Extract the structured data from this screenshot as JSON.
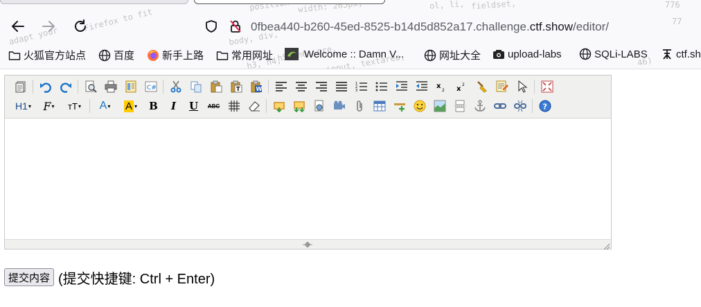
{
  "browser": {
    "url_domain_prefix": "0fbea440-b260-45ed-8525-b14d5d852a17.challenge.",
    "url_domain_main": "ctf.show",
    "url_path": "/editor/",
    "theme_text": [
      "position",
      "width: 265px;",
      "ol, li,",
      "fieldset,",
      "adapt your",
      "Firefox to fit",
      "body, div,",
      "h5, h6, pre,",
      "input, textarea,",
      "776",
      "77",
      "46)",
      "h3, h4,"
    ],
    "nav_icons": [
      "back-arrow-icon",
      "forward-arrow-icon",
      "reload-icon",
      "shield-icon",
      "insecure-lock-icon"
    ]
  },
  "bookmarks": [
    {
      "label": "火狐官方站点",
      "icon": "folder-icon"
    },
    {
      "label": "百度",
      "icon": "globe-icon"
    },
    {
      "label": "新手上路",
      "icon": "firefox-icon"
    },
    {
      "label": "常用网址",
      "icon": "folder-icon"
    },
    {
      "label": "Welcome :: Damn V...",
      "icon": "dvwa-icon"
    },
    {
      "label": "网址大全",
      "icon": "globe-icon"
    },
    {
      "label": "upload-labs",
      "icon": "camera-icon"
    },
    {
      "label": "SQLi-LABS",
      "icon": "globe-icon"
    },
    {
      "label": "ctf.sh",
      "icon": "ctfshow-icon"
    }
  ],
  "editor": {
    "toolbar_row1": [
      "source",
      "undo",
      "redo",
      "preview",
      "print",
      "template",
      "code",
      "cut",
      "copy",
      "paste",
      "paste-text",
      "paste-word",
      "justify-left",
      "justify-center",
      "justify-right",
      "justify-full",
      "ordered-list",
      "unordered-list",
      "indent",
      "outdent",
      "subscript",
      "superscript",
      "clear-format",
      "select-all",
      "cursor",
      "fullscreen"
    ],
    "toolbar_row2_text": {
      "heading": "H1",
      "font": "F",
      "size": "тT",
      "fore": "A",
      "back": "A",
      "bold": "B",
      "italic": "I",
      "underline": "U",
      "strike": "ABC"
    },
    "toolbar_row2": [
      "table-grid",
      "eraser",
      "image",
      "multi-image",
      "flash",
      "media",
      "attachment",
      "insert-table",
      "horizontal-rule",
      "emoticon",
      "baidu-map",
      "page-break",
      "anchor",
      "link",
      "unlink",
      "help"
    ],
    "accent_color": "#1a73c9",
    "highlight_color": "#ffcc00"
  },
  "form": {
    "submit_label": "提交内容",
    "shortcut_text": "(提交快捷键: Ctrl + Enter)"
  }
}
